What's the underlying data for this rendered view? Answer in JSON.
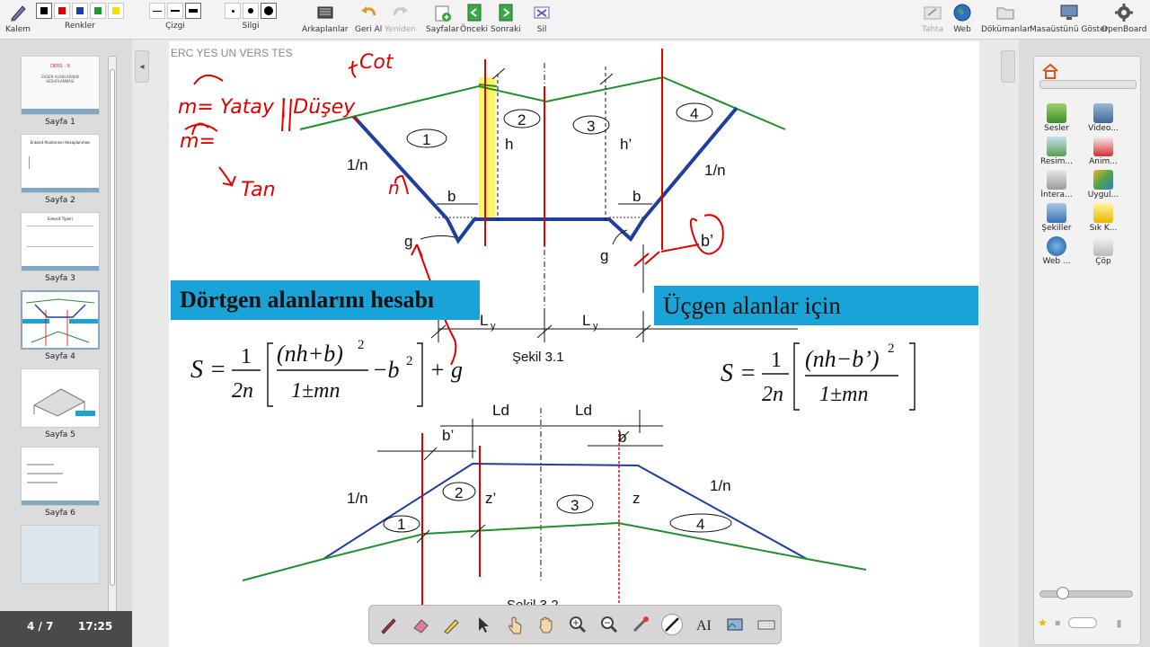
{
  "toolbar": {
    "pen_label": "Kalem",
    "colors_label": "Renkler",
    "line_label": "Çizgi",
    "eraser_label": "Silgi",
    "backgrounds_label": "Arkaplanlar",
    "undo_label": "Geri Al",
    "redo_label": "Yeniden",
    "pages_label": "Sayfalar",
    "previous_label": "Önceki",
    "next_label": "Sonraki",
    "delete_label": "Sil",
    "board_label": "Tahta",
    "web_label": "Web",
    "documents_label": "Dökümanlar",
    "show_desktop_label": "Masaüstünü Göster",
    "openboard_label": "OpenBoard",
    "colors": [
      "#000000",
      "#e00000",
      "#1f3f9e",
      "#1a9c2a",
      "#f2e400"
    ]
  },
  "left_panel": {
    "pages": [
      {
        "label": "Sayfa 1",
        "title": "DERS - 8",
        "subtitle": "EKSEN ALANLARININ HESAPLANMASI"
      },
      {
        "label": "Sayfa 2",
        "title": "Enkesit Alanlarının Hesaplanması"
      },
      {
        "label": "Sayfa 3",
        "title": "Enkesit Tipleri"
      },
      {
        "label": "Sayfa 4"
      },
      {
        "label": "Sayfa 5"
      },
      {
        "label": "Sayfa 6"
      }
    ],
    "page_counter": "4 / 7",
    "clock": "17:25"
  },
  "board": {
    "header_text": "ERC YES UN VERS TES",
    "square_areas_title": "Dörtgen alanlarını hesabı",
    "triangle_areas_title": "Üçgen alanlar için",
    "figure1_caption": "Şekil 3.1",
    "figure2_caption": "Şekil 3.2",
    "fig1_labels": {
      "slope_left": "1/n",
      "slope_right": "1/n",
      "b_left": "b",
      "b_right": "b",
      "h": "h",
      "h_prime": "h’",
      "g_left": "g",
      "g_right": "g",
      "area1": "1",
      "area2": "2",
      "area3": "3",
      "area4": "4",
      "ly_left": "L",
      "ly_right": "L",
      "ly_sub": "y"
    },
    "fig2_labels": {
      "ld_left": "Ld",
      "ld_right": "Ld",
      "b_prime": "b’",
      "b_right": "b",
      "slope_left": "1/n",
      "slope_right": "1/n",
      "z_prime": "z’",
      "z": "z",
      "area1": "1",
      "area2": "2",
      "area3": "3",
      "area4": "4"
    },
    "handwriting": {
      "m_def": "m= Yatay | Düşey",
      "cot": "Cot",
      "m_eq": "m=",
      "tan": "Tan",
      "n": "n",
      "b_prime": "b’"
    },
    "formula1": {
      "lhs": "S =",
      "num": "1",
      "den": "2n",
      "inner_num": "(nh+b)",
      "power": "2",
      "inner_den": "1±mn",
      "minus_b2": "−b",
      "plus_g": "+ g"
    },
    "formula2": {
      "lhs": "S =",
      "num": "1",
      "den": "2n",
      "inner_num": "(nh−b’)",
      "power": "2",
      "inner_den": "1±mn"
    }
  },
  "right_panel": {
    "items": [
      {
        "label": "Sesler",
        "icon": "sounds-icon"
      },
      {
        "label": "Video...",
        "icon": "videos-icon"
      },
      {
        "label": "Resim...",
        "icon": "images-icon"
      },
      {
        "label": "Anim...",
        "icon": "animations-icon"
      },
      {
        "label": "İntera...",
        "icon": "interactive-icon"
      },
      {
        "label": "Uygul...",
        "icon": "applications-icon"
      },
      {
        "label": "Şekiller",
        "icon": "shapes-icon"
      },
      {
        "label": "Sık K...",
        "icon": "favorites-icon"
      },
      {
        "label": "Web ...",
        "icon": "web-icon"
      },
      {
        "label": "Çöp",
        "icon": "trash-icon"
      }
    ]
  }
}
